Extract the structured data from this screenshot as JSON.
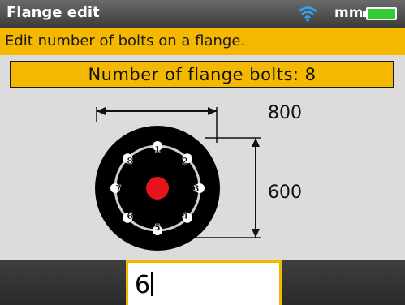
{
  "titlebar": {
    "title": "Flange edit",
    "units": "mm",
    "wifi_icon": "wifi-icon",
    "battery_icon": "battery-icon",
    "battery_color": "#33cc33"
  },
  "hint": "Edit number of bolts on a flange.",
  "bolt_label": "Number of flange bolts: 8",
  "flange": {
    "width_label": "800",
    "height_label": "600",
    "bolts": [
      "1",
      "2",
      "3",
      "4",
      "5",
      "6",
      "7",
      "8"
    ],
    "center_color": "#e8141c"
  },
  "entry": {
    "value": "6"
  },
  "colors": {
    "accent": "#f5b800",
    "background": "#dcdcdc"
  }
}
